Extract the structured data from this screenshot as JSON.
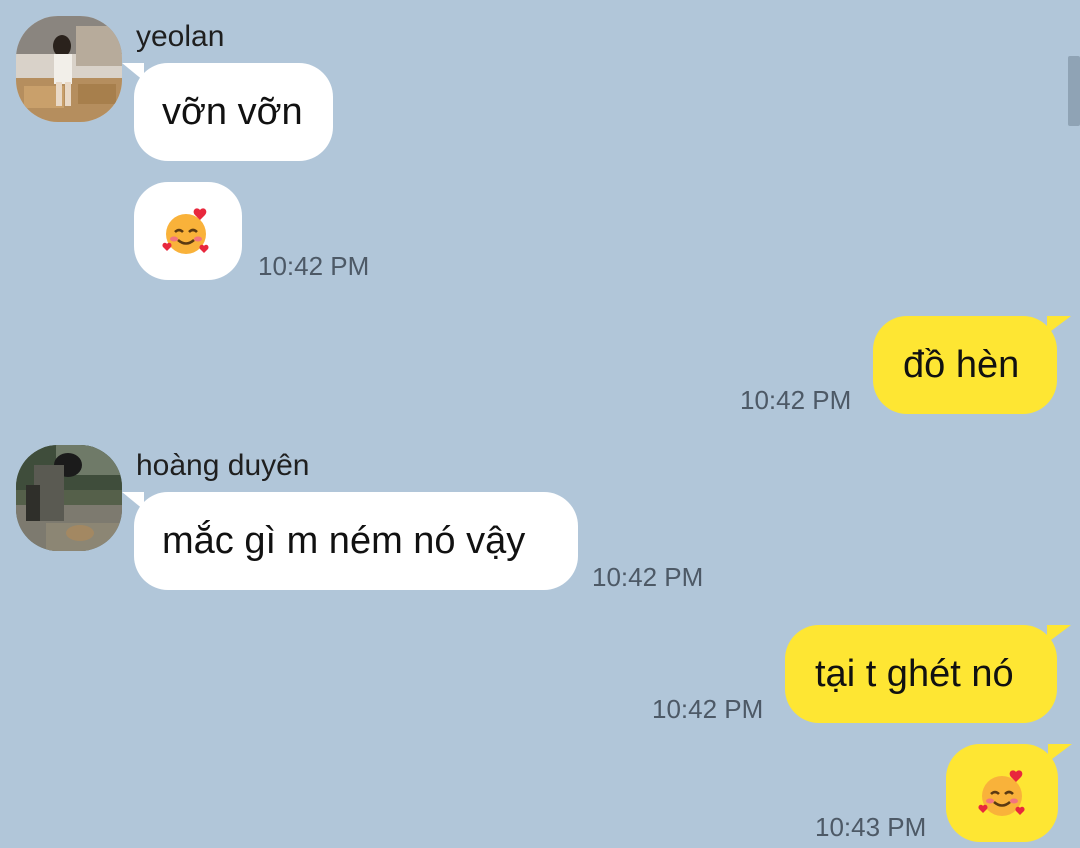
{
  "colors": {
    "background": "#b1c6d9",
    "incoming_bubble": "#ffffff",
    "outgoing_bubble": "#fee633",
    "timestamp": "#4d5966"
  },
  "messages": [
    {
      "direction": "incoming",
      "sender": "yeolan",
      "text": "vỡn vỡn",
      "time": ""
    },
    {
      "direction": "incoming",
      "sender": "yeolan",
      "emoji": "smiling-face-with-hearts",
      "time": "10:42 PM"
    },
    {
      "direction": "outgoing",
      "text": "đồ hèn",
      "time": "10:42 PM"
    },
    {
      "direction": "incoming",
      "sender": "hoàng duyên",
      "text": "mắc gì m ném nó vậy",
      "time": "10:42 PM"
    },
    {
      "direction": "outgoing",
      "text": "tại t ghét nó",
      "time": "10:42 PM"
    },
    {
      "direction": "outgoing",
      "emoji": "smiling-face-with-hearts",
      "time": "10:43 PM"
    }
  ]
}
